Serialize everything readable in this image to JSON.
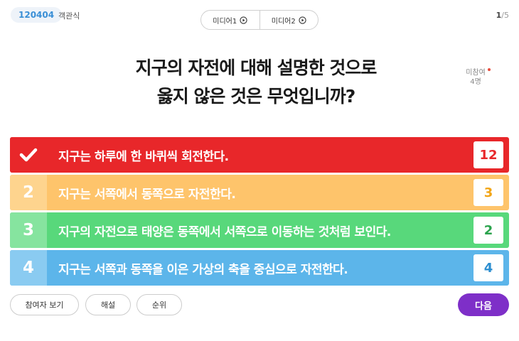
{
  "header": {
    "quiz_id": "120404",
    "quiz_type": "객관식",
    "media": [
      {
        "label": "미디어1"
      },
      {
        "label": "미디어2"
      }
    ],
    "page_current": "1",
    "page_total": "/5"
  },
  "question": {
    "line1": "지구의 자전에 대해 설명한 것으로",
    "line2": "옳지 않은 것은 무엇입니까?"
  },
  "absent": {
    "label": "미참여",
    "count": "4명"
  },
  "answers": [
    {
      "marker": "✔",
      "text": "지구는 하루에 한 바퀴씩 회전한다.",
      "count": "12",
      "correct": true
    },
    {
      "marker": "2",
      "text": "지구는 서쪽에서 동쪽으로 자전한다.",
      "count": "3"
    },
    {
      "marker": "3",
      "text": "지구의 자전으로 태양은 동쪽에서 서쪽으로 이동하는 것처럼 보인다.",
      "count": "2"
    },
    {
      "marker": "4",
      "text": "지구는 서쪽과 동쪽을 이은 가상의 축을 중심으로 자전한다.",
      "count": "4"
    }
  ],
  "footer": {
    "participants_button": "참여자 보기",
    "explanation_button": "해설",
    "ranking_button": "순위",
    "next_button": "다음"
  },
  "colors": {
    "answer1": "#e8272a",
    "answer2": "#fec46b",
    "answer3": "#58d87b",
    "answer4": "#5cb5ea",
    "next": "#7e2fc8",
    "quiz_id": "#3a8fd6"
  },
  "icons": {
    "media_play": "play-circle-icon",
    "correct": "check-icon"
  }
}
